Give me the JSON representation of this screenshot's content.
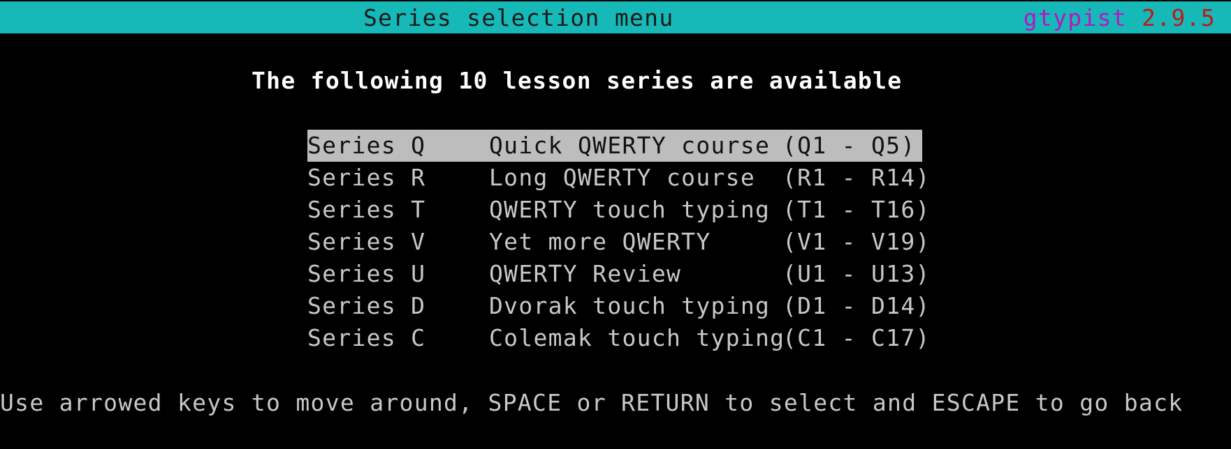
{
  "titlebar": {
    "title": "Series selection menu",
    "app_name": "gtypist",
    "version": "2.9.5"
  },
  "heading": "The following 10 lesson series are available",
  "menu": {
    "selected_index": 0,
    "items": [
      {
        "series": "Series Q",
        "description": "Quick QWERTY course",
        "range": "(Q1 - Q5)"
      },
      {
        "series": "Series R",
        "description": "Long QWERTY course",
        "range": "(R1 - R14)"
      },
      {
        "series": "Series T",
        "description": "QWERTY touch typing",
        "range": "(T1 - T16)"
      },
      {
        "series": "Series V",
        "description": "Yet more QWERTY",
        "range": "(V1 - V19)"
      },
      {
        "series": "Series U",
        "description": "QWERTY Review",
        "range": "(U1 - U13)"
      },
      {
        "series": "Series D",
        "description": "Dvorak touch typing",
        "range": "(D1 - D14)"
      },
      {
        "series": "Series C",
        "description": "Colemak touch typing",
        "range": "(C1 - C17)"
      }
    ]
  },
  "hint": "Use arrowed keys to move around, SPACE or RETURN to select and ESCAPE to go back",
  "colors": {
    "titlebar_bg": "#17b8b8",
    "app_name": "#b418c0",
    "version": "#c01818",
    "selected_bg": "#bdbdbd",
    "text": "#c8c8c8",
    "background": "#000000"
  }
}
